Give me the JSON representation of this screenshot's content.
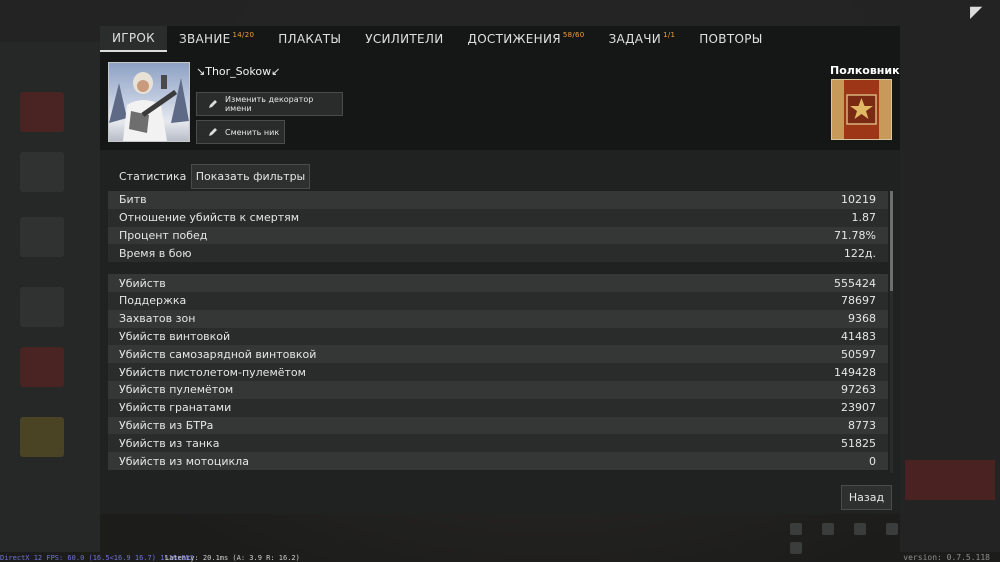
{
  "tabs": [
    {
      "label": "ИГРОК",
      "badge": ""
    },
    {
      "label": "ЗВАНИЕ",
      "badge": "14/20"
    },
    {
      "label": "ПЛАКАТЫ",
      "badge": ""
    },
    {
      "label": "УСИЛИТЕЛИ",
      "badge": ""
    },
    {
      "label": "ДОСТИЖЕНИЯ",
      "badge": "58/60"
    },
    {
      "label": "ЗАДАЧИ",
      "badge": "1/1"
    },
    {
      "label": "ПОВТОРЫ",
      "badge": ""
    }
  ],
  "profile": {
    "nickname": "Thor_Sokow",
    "change_decorator_label": "Изменить декоратор имени",
    "change_nick_label": "Сменить ник",
    "rank_name": "Полковник"
  },
  "stats": {
    "header": "Статистика",
    "filters_label": "Показать фильтры",
    "group1": [
      {
        "label": "Битв",
        "value": "10219"
      },
      {
        "label": "Отношение убийств к смертям",
        "value": "1.87"
      },
      {
        "label": "Процент побед",
        "value": "71.78%"
      },
      {
        "label": "Время в бою",
        "value": "122д."
      }
    ],
    "group2": [
      {
        "label": "Убийств",
        "value": "555424"
      },
      {
        "label": "Поддержка",
        "value": "78697"
      },
      {
        "label": "Захватов зон",
        "value": "9368"
      },
      {
        "label": "Убийств винтовкой",
        "value": "41483"
      },
      {
        "label": "Убийств самозарядной винтовкой",
        "value": "50597"
      },
      {
        "label": "Убийств пистолетом-пулемётом",
        "value": "149428"
      },
      {
        "label": "Убийств пулемётом",
        "value": "97263"
      },
      {
        "label": "Убийств гранатами",
        "value": "23907"
      },
      {
        "label": "Убийств из БТРа",
        "value": "8773"
      },
      {
        "label": "Убийств из танка",
        "value": "51825"
      },
      {
        "label": "Убийств из мотоцикла",
        "value": "0"
      }
    ]
  },
  "back_label": "Назад",
  "footer": {
    "fps": "DirectX 12 FPS: 60.0 (16.5<16.9 16.7) 1516x852",
    "latency": "Latency: 20.1ms (A: 3.9 R: 16.2)",
    "version": "version: 0.7.5.118"
  },
  "colors": {
    "accent_badge": "#f0a13a",
    "rank_badge": "#a8401c"
  }
}
